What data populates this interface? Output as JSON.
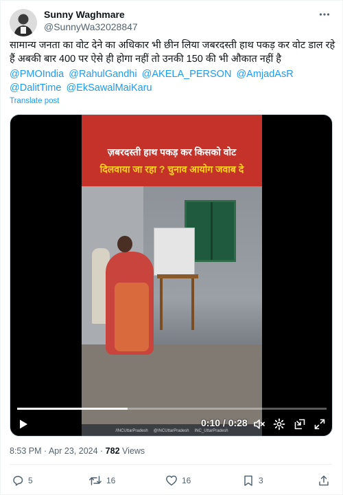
{
  "user": {
    "display_name": "Sunny Waghmare",
    "handle": "@SunnyWa32028847"
  },
  "post": {
    "text": "सामान्य जनता का वोट देने का अधिकार भी छीन लिया जबरदस्ती हाथ पकड़ कर वोट डाल रहे हैं अबकी बार 400 पर ऐसे ही होगा नहीं तो उनकी 150 की भी औकात नहीं है",
    "mentions": [
      "@PMOIndia",
      "@RahulGandhi",
      "@AKELA_PERSON",
      "@AmjadAsR",
      "@DalitTime",
      "@EkSawalMaiKaru"
    ],
    "translate_label": "Translate post"
  },
  "video": {
    "banner_line1": "ज़बरदस्ती हाथ पकड़ कर किसको वोट",
    "banner_line2": "दिलवाया जा रहा ? चुनाव आयोग जवाब दे",
    "watermarks": [
      "/INCUttarPradesh",
      "@INCUttarPradesh",
      "INC_UttarPradesh"
    ],
    "time_display": "0:10 / 0:28",
    "progress": 0.357
  },
  "meta": {
    "timestamp": "8:53 PM · Apr 23, 2024 · ",
    "views_count": "782",
    "views_label": " Views"
  },
  "actions": {
    "replies": "5",
    "reposts": "16",
    "likes": "16",
    "bookmarks": "3"
  },
  "colors": {
    "accent": "#1d9bf0",
    "banner_red": "#c5322a",
    "banner_yellow": "#ffd21f",
    "secondary_text": "#536471"
  }
}
